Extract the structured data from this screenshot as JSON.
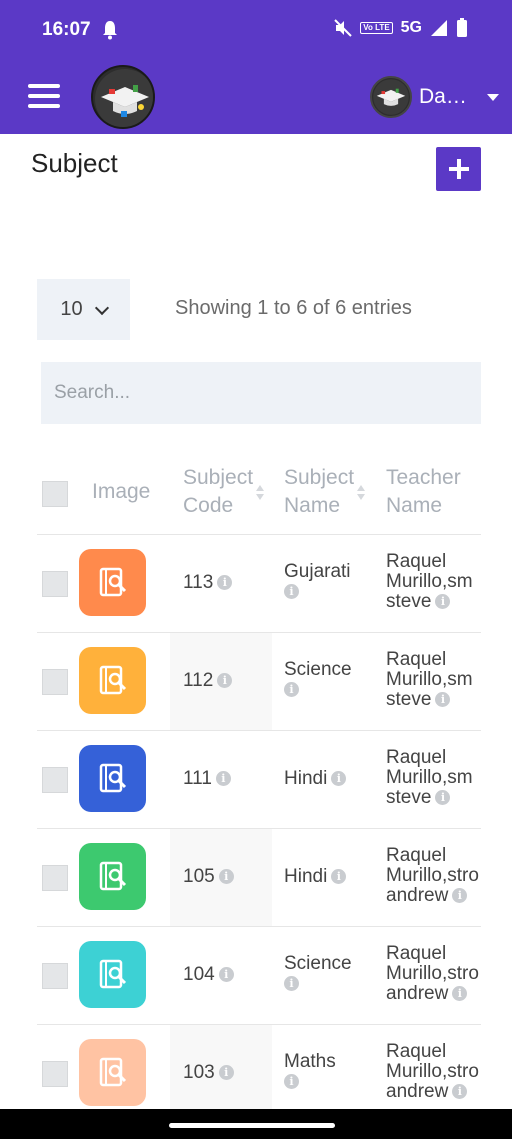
{
  "status_bar": {
    "time": "16:07",
    "network": "5G",
    "volte": "Vo LTE"
  },
  "app_bar": {
    "user_name": "Dashboard"
  },
  "page": {
    "title": "Subject"
  },
  "table_controls": {
    "page_size": "10",
    "entries_text": "Showing 1 to 6 of 6 entries",
    "search_placeholder": "Search..."
  },
  "table": {
    "headers": {
      "image": "Image",
      "code_line1": "Subject",
      "code_line2": "Code",
      "name_line1": "Subject",
      "name_line2": "Name",
      "teacher_line1": "Teacher",
      "teacher_line2": "Name"
    },
    "rows": [
      {
        "code": "113",
        "name": "Gujarati",
        "teacher_line1": "Raquel",
        "teacher_line2": "Murillo,sm",
        "teacher_line3": "steve",
        "color": "#ff8a4c"
      },
      {
        "code": "112",
        "name": "Science",
        "teacher_line1": "Raquel",
        "teacher_line2": "Murillo,sm",
        "teacher_line3": "steve",
        "color": "#ffb13b"
      },
      {
        "code": "111",
        "name": "Hindi",
        "teacher_line1": "Raquel",
        "teacher_line2": "Murillo,sm",
        "teacher_line3": "steve",
        "color": "#3561d8"
      },
      {
        "code": "105",
        "name": "Hindi",
        "teacher_line1": "Raquel",
        "teacher_line2": "Murillo,stro",
        "teacher_line3": "andrew",
        "color": "#3dc96f"
      },
      {
        "code": "104",
        "name": "Science",
        "teacher_line1": "Raquel",
        "teacher_line2": "Murillo,stro",
        "teacher_line3": "andrew",
        "color": "#3dd1d4"
      },
      {
        "code": "103",
        "name": "Maths",
        "teacher_line1": "Raquel",
        "teacher_line2": "Murillo,stro",
        "teacher_line3": "andrew",
        "color": "#ffc3a3"
      }
    ]
  },
  "icons": {
    "menu": "hamburger-icon",
    "add": "plus-icon",
    "subject": "book-search-icon",
    "info": "info-icon"
  }
}
